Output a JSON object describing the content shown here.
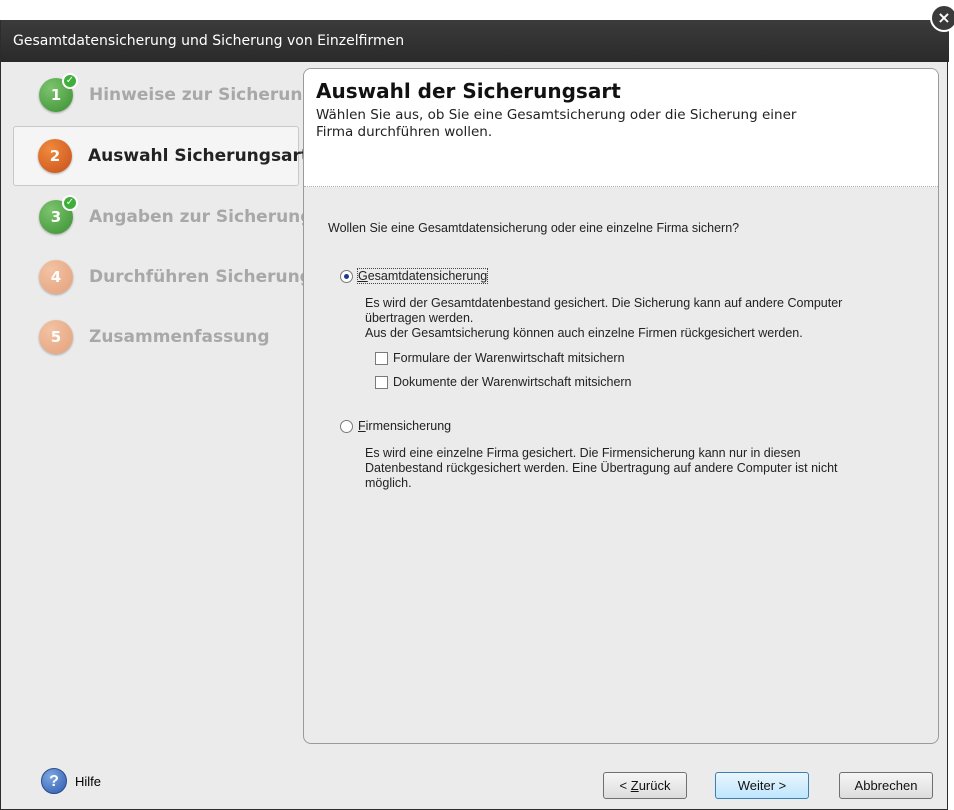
{
  "window": {
    "title": "Gesamtdatensicherung und Sicherung von Einzelfirmen"
  },
  "sidebar": {
    "steps": [
      {
        "number": "1",
        "label": "Hinweise zur Sicherung",
        "state": "done"
      },
      {
        "number": "2",
        "label": "Auswahl Sicherungsart",
        "state": "active"
      },
      {
        "number": "3",
        "label": "Angaben zur Sicherung",
        "state": "done"
      },
      {
        "number": "4",
        "label": "Durchführen Sicherung",
        "state": "pending"
      },
      {
        "number": "5",
        "label": "Zusammenfassung",
        "state": "pending"
      }
    ]
  },
  "panel": {
    "title": "Auswahl der Sicherungsart",
    "subtitle": "Wählen Sie aus, ob Sie eine Gesamtsicherung oder die Sicherung einer Firma durchführen wollen.",
    "question": "Wollen Sie eine Gesamtdatensicherung oder eine einzelne Firma sichern?",
    "option1": {
      "label_first": "G",
      "label_rest": "esamtdatensicherung",
      "checked": true,
      "desc_line1": "Es wird der Gesamtdatenbestand gesichert. Die Sicherung kann auf andere Computer übertragen werden.",
      "desc_line2": "Aus der Gesamtsicherung können auch einzelne Firmen rückgesichert werden.",
      "cb1": "Formulare der Warenwirtschaft mitsichern",
      "cb2": "Dokumente der Warenwirtschaft mitsichern"
    },
    "option2": {
      "label_first": "F",
      "label_rest": "irmensicherung",
      "checked": false,
      "desc": "Es wird eine einzelne Firma gesichert. Die Firmensicherung kann nur in diesen Datenbestand rückgesichert werden. Eine Übertragung auf andere Computer ist nicht möglich."
    }
  },
  "footer": {
    "help_label": "Hilfe",
    "back_prefix": "< ",
    "back_first": "Z",
    "back_rest": "urück",
    "next_label": "Weiter >",
    "cancel_label": "Abbrechen"
  }
}
